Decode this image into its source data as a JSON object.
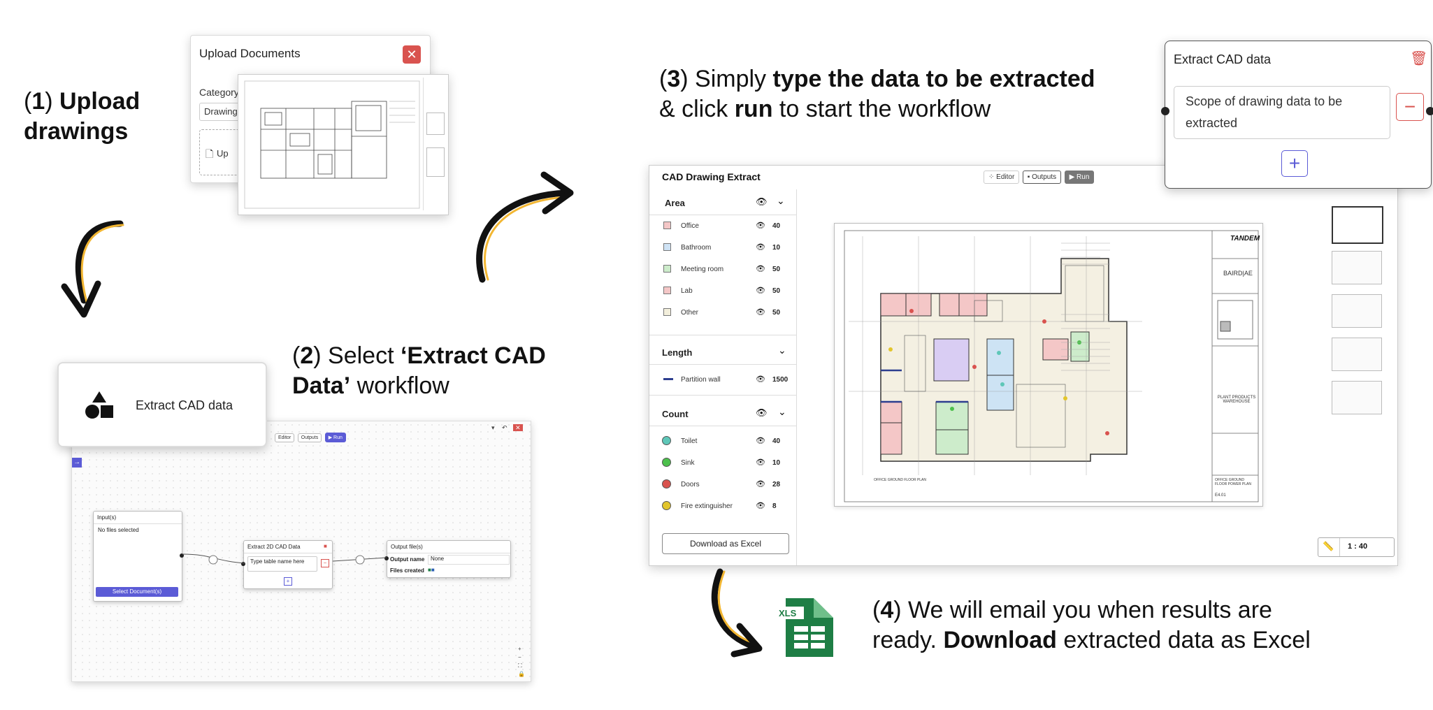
{
  "steps": {
    "step1": {
      "num": "1",
      "text": "Upload drawings"
    },
    "step2": {
      "num": "2",
      "prefix": "Select",
      "bold": "‘Extract CAD Data’",
      "suffix": "workflow"
    },
    "step3": {
      "num": "3",
      "prefix": "Simply",
      "bold1": "type the data to be extracted",
      "mid": "& click",
      "bold2": "run",
      "suffix": "to start the workflow"
    },
    "step4": {
      "num": "4",
      "line1": "We will email you when results are",
      "line2_prefix": "ready.",
      "bold": "Download",
      "line2_suffix": "extracted data as Excel"
    }
  },
  "upload_modal": {
    "title": "Upload Documents",
    "close": "✕",
    "category_label": "Category",
    "category_value": "Drawing",
    "upload_label": "Up"
  },
  "workflow": {
    "card_label": "Extract CAD data",
    "toolbar": {
      "editor": "Editor",
      "outputs": "Outputs",
      "run": "▶ Run"
    },
    "input_node": {
      "title": "Input(s)",
      "empty": "No files selected",
      "button": "Select Document(s)"
    },
    "extract_node": {
      "title": "Extract 2D CAD Data",
      "placeholder": "Type table name here"
    },
    "output_node": {
      "title": "Output file(s)",
      "name_label": "Output name",
      "name_value": "None",
      "files_label": "Files created"
    }
  },
  "extract_card": {
    "title": "Extract CAD data",
    "scope_placeholder": "Scope of drawing data to be extracted",
    "minus": "−",
    "plus": "+"
  },
  "cad_app": {
    "title": "CAD Drawing Extract",
    "toolbar": {
      "editor": "Editor",
      "outputs": "Outputs",
      "run": "▶ Run"
    },
    "area": {
      "title": "Area",
      "items": [
        {
          "label": "Office",
          "value": "40",
          "color": "#f4c7c7"
        },
        {
          "label": "Bathroom",
          "value": "10",
          "color": "#cfe3f5"
        },
        {
          "label": "Meeting room",
          "value": "50",
          "color": "#cdeccb"
        },
        {
          "label": "Lab",
          "value": "50",
          "color": "#f4c7c7"
        },
        {
          "label": "Other",
          "value": "50",
          "color": "#f3efdc"
        }
      ]
    },
    "length": {
      "title": "Length",
      "items": [
        {
          "label": "Partition wall",
          "value": "1500",
          "color": "#2d3e8f"
        }
      ]
    },
    "count": {
      "title": "Count",
      "items": [
        {
          "label": "Toilet",
          "value": "40",
          "color": "#5ec7b8"
        },
        {
          "label": "Sink",
          "value": "10",
          "color": "#4cc04c"
        },
        {
          "label": "Doors",
          "value": "28",
          "color": "#d9534f"
        },
        {
          "label": "Fire extinguisher",
          "value": "8",
          "color": "#e2c52c"
        }
      ]
    },
    "download_button": "Download as Excel",
    "scale": "1 : 40",
    "drawing": {
      "tandem": "TANDEM",
      "baird": "BAIRD|AE",
      "plant": "PLANT PRODUCTS WAREHOUSE",
      "sheet_title": "OFFICE GROUND FLOOR POWER PLAN",
      "sheet_no": "E4.01",
      "plan_label": "OFFICE GROUND FLOOR PLAN"
    }
  },
  "excel_icon": {
    "text": "XLS",
    "color": "#1e7e45"
  }
}
